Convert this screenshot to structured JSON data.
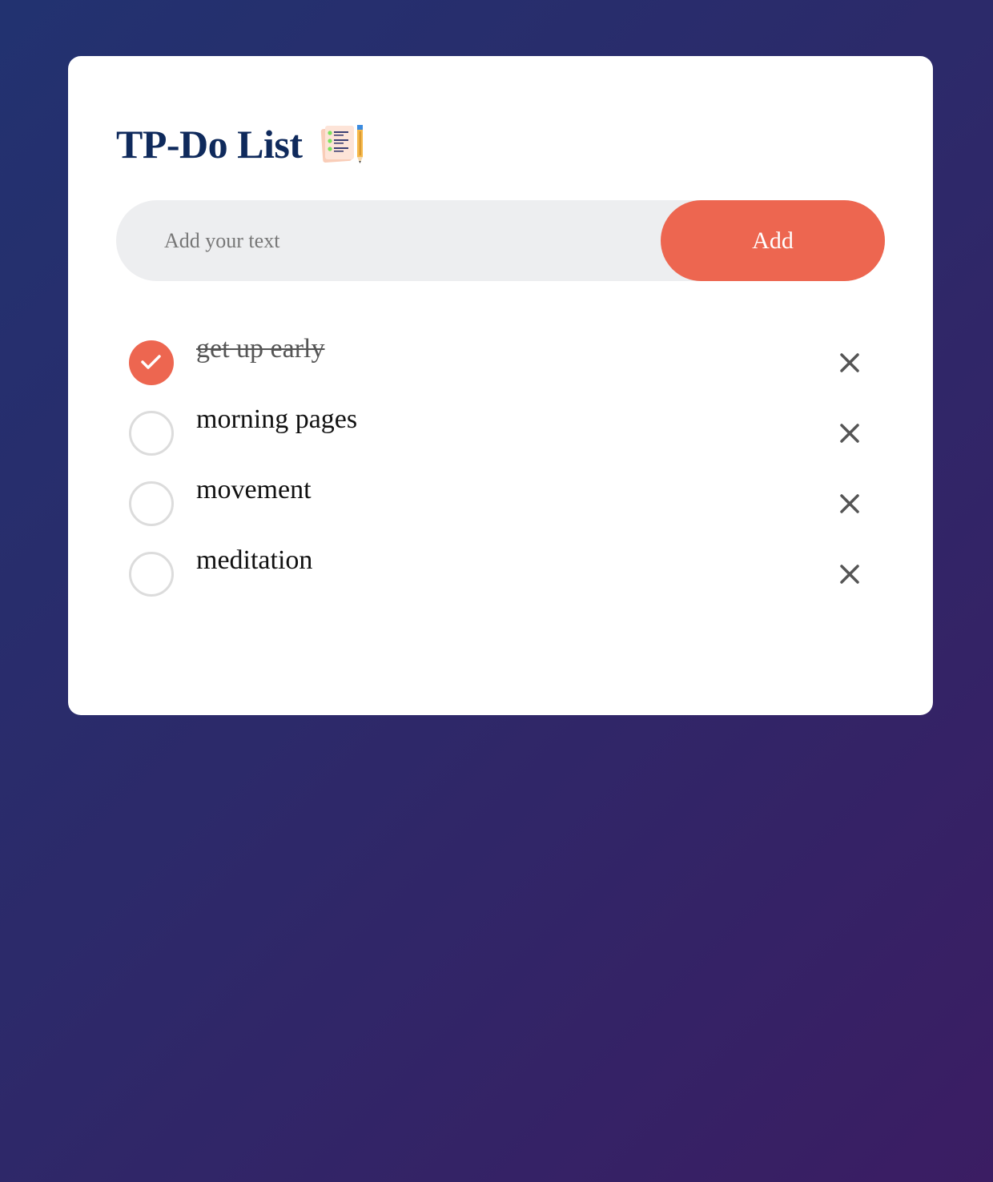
{
  "app": {
    "title": "TP-Do List",
    "title_icon": "notepad-pencil-icon"
  },
  "input": {
    "placeholder": "Add your text",
    "value": ""
  },
  "add_button": {
    "label": "Add"
  },
  "colors": {
    "accent": "#ed6650",
    "title": "#0f2a5c",
    "background_start": "#223270",
    "background_end": "#3b1d63"
  },
  "tasks": [
    {
      "text": "get up early",
      "done": true
    },
    {
      "text": "morning pages",
      "done": false
    },
    {
      "text": "movement",
      "done": false
    },
    {
      "text": "meditation",
      "done": false
    }
  ]
}
